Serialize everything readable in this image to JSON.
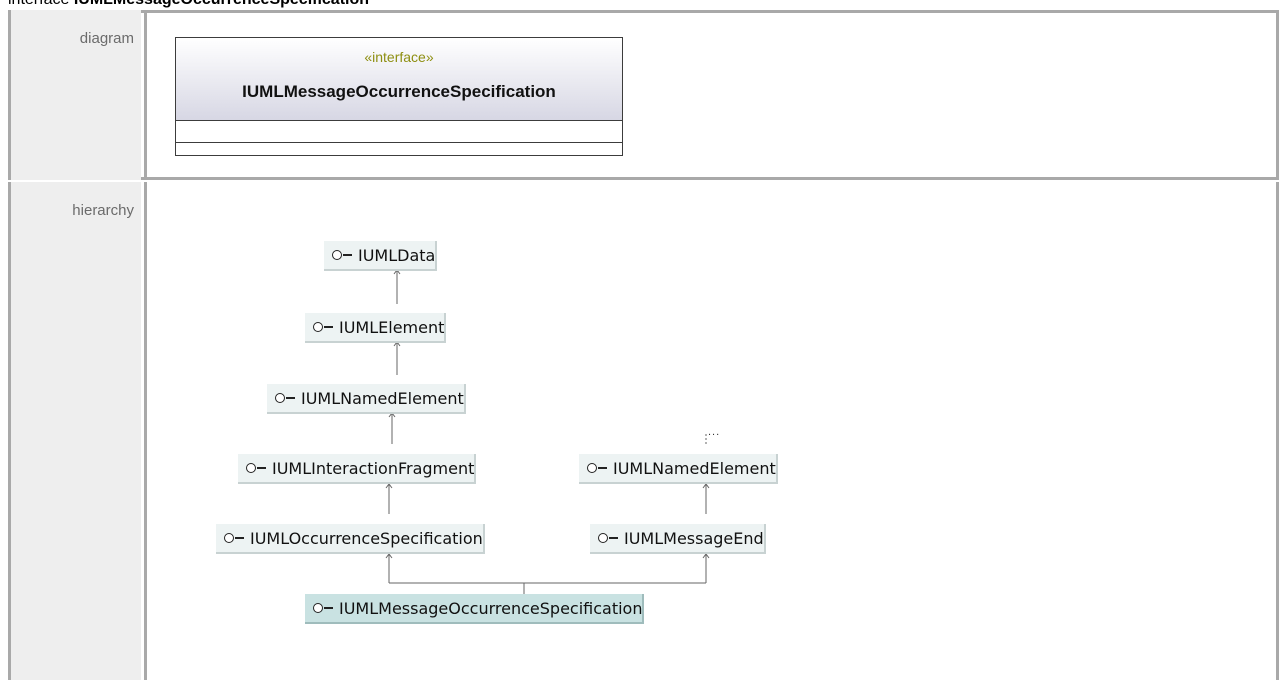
{
  "heading": {
    "prefix": "interface ",
    "name": "IUMLMessageOccurrenceSpecification"
  },
  "rows": {
    "diagram_label": "diagram",
    "hierarchy_label": "hierarchy"
  },
  "uml_class": {
    "stereotype": "«interface»",
    "name": "IUMLMessageOccurrenceSpecification"
  },
  "hierarchy": {
    "nodes": [
      "IUMLData",
      "IUMLElement",
      "IUMLNamedElement",
      "IUMLInteractionFragment",
      "IUMLNamedElement",
      "IUMLOccurrenceSpecification",
      "IUMLMessageEnd",
      "IUMLMessageOccurrenceSpecification"
    ],
    "truncated_marker": "..."
  },
  "colors": {
    "node_bg": "#edf3f3",
    "selected_node_bg": "#c9e2e2",
    "stereotype": "#8e8f12",
    "border": "#a9a9a9"
  }
}
